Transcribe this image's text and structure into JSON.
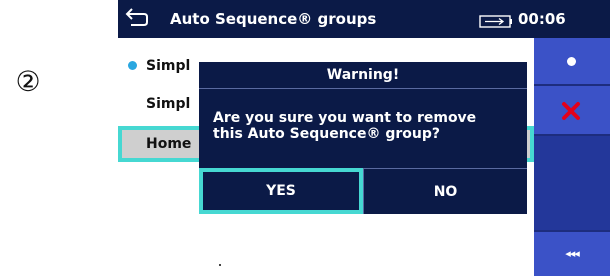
{
  "step_marker": "②",
  "header": {
    "title": "Auto Sequence® groups",
    "time": "00:06",
    "back_icon": "back-arrow-icon",
    "battery_icon": "battery-plug-icon"
  },
  "list": {
    "items": [
      {
        "label": "Simpl"
      },
      {
        "label": "Simpl"
      },
      {
        "label": "Home"
      }
    ]
  },
  "sidebar": {
    "icons": [
      "dot-icon",
      "close-icon",
      "collapse-icon"
    ],
    "collapse_label": "◂◂◂"
  },
  "dialog": {
    "title": "Warning!",
    "message_line1": "Are you sure you want to remove",
    "message_line2": "this Auto Sequence® group?",
    "yes_label": "YES",
    "no_label": "NO"
  },
  "colors": {
    "header_bg": "#0b1a47",
    "sidebar_bg": "#23379a",
    "accent_cyan": "#46d8d2",
    "bullet_blue": "#2aa7e0",
    "close_red": "#e3001b"
  }
}
